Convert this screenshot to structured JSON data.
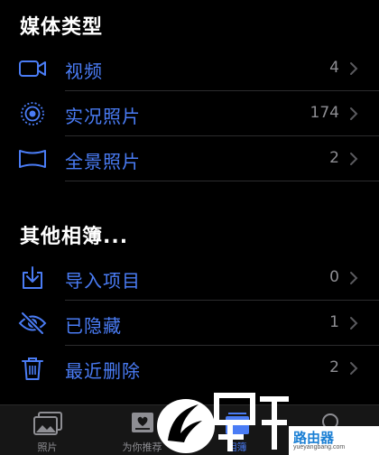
{
  "media_types": {
    "title": "媒体类型",
    "items": [
      {
        "label": "视频",
        "count": "4",
        "icon": "video-icon"
      },
      {
        "label": "实况照片",
        "count": "174",
        "icon": "live-photo-icon"
      },
      {
        "label": "全景照片",
        "count": "2",
        "icon": "panorama-icon"
      }
    ]
  },
  "other_albums": {
    "title": "其他相簿...",
    "items": [
      {
        "label": "导入项目",
        "count": "0",
        "icon": "import-icon"
      },
      {
        "label": "已隐藏",
        "count": "1",
        "icon": "eye-slash-icon"
      },
      {
        "label": "最近删除",
        "count": "2",
        "icon": "trash-icon"
      }
    ]
  },
  "tabbar": {
    "tabs": [
      {
        "label": "照片",
        "icon": "photos-icon",
        "active": false
      },
      {
        "label": "为你推荐",
        "icon": "for-you-icon",
        "active": false
      },
      {
        "label": "相簿",
        "icon": "albums-icon",
        "active": true
      },
      {
        "label": "",
        "icon": "search-icon",
        "active": false
      }
    ]
  },
  "colors": {
    "accent": "#4a7cf5",
    "count": "#8e8e93",
    "background": "#000000"
  },
  "watermark": {
    "text": "路由器",
    "sub": "yueyangbang.com"
  }
}
